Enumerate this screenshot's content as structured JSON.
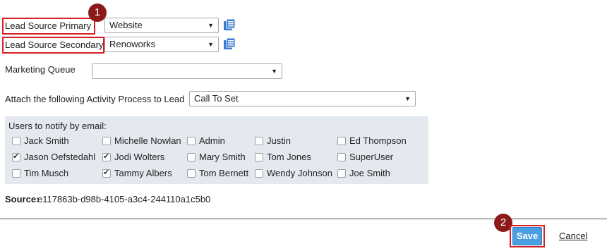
{
  "lead_source_primary": {
    "label": "Lead Source Primary",
    "value": "Website"
  },
  "lead_source_secondary": {
    "label": "Lead Source Secondary",
    "value": "Renoworks"
  },
  "marketing_queue": {
    "label": "Marketing Queue",
    "value": ""
  },
  "activity_process": {
    "label": "Attach the following Activity Process to Lead",
    "value": "Call To Set"
  },
  "notify": {
    "heading": "Users to notify by email:",
    "users": [
      {
        "name": "Jack Smith",
        "checked": false
      },
      {
        "name": "Michelle Nowlan",
        "checked": false
      },
      {
        "name": "Admin",
        "checked": false
      },
      {
        "name": "Justin",
        "checked": false
      },
      {
        "name": "Ed Thompson",
        "checked": false
      },
      {
        "name": "Jason Oefstedahl",
        "checked": true
      },
      {
        "name": "Jodi Wolters",
        "checked": true
      },
      {
        "name": "Mary Smith",
        "checked": false
      },
      {
        "name": "Tom Jones",
        "checked": false
      },
      {
        "name": "SuperUser",
        "checked": false
      },
      {
        "name": "Tim Musch",
        "checked": false
      },
      {
        "name": "Tammy Albers",
        "checked": true
      },
      {
        "name": "Tom Bernett",
        "checked": false
      },
      {
        "name": "Wendy Johnson",
        "checked": false
      },
      {
        "name": "Joe Smith",
        "checked": false
      }
    ]
  },
  "source": {
    "label": "Source:",
    "value": "e117863b-d98b-4105-a3c4-244110a1c5b0"
  },
  "actions": {
    "save_label": "Save",
    "cancel_label": "Cancel"
  },
  "markers": {
    "one": "1",
    "two": "2"
  },
  "icons": {
    "dropdown": "dropdown-arrow-icon",
    "list": "list-icon"
  },
  "colors": {
    "highlight": "#d61f27",
    "marker": "#8b1a1a",
    "save": "#4a9fe0",
    "panel": "#e4e9f0",
    "icon": "#3a7bd5"
  }
}
